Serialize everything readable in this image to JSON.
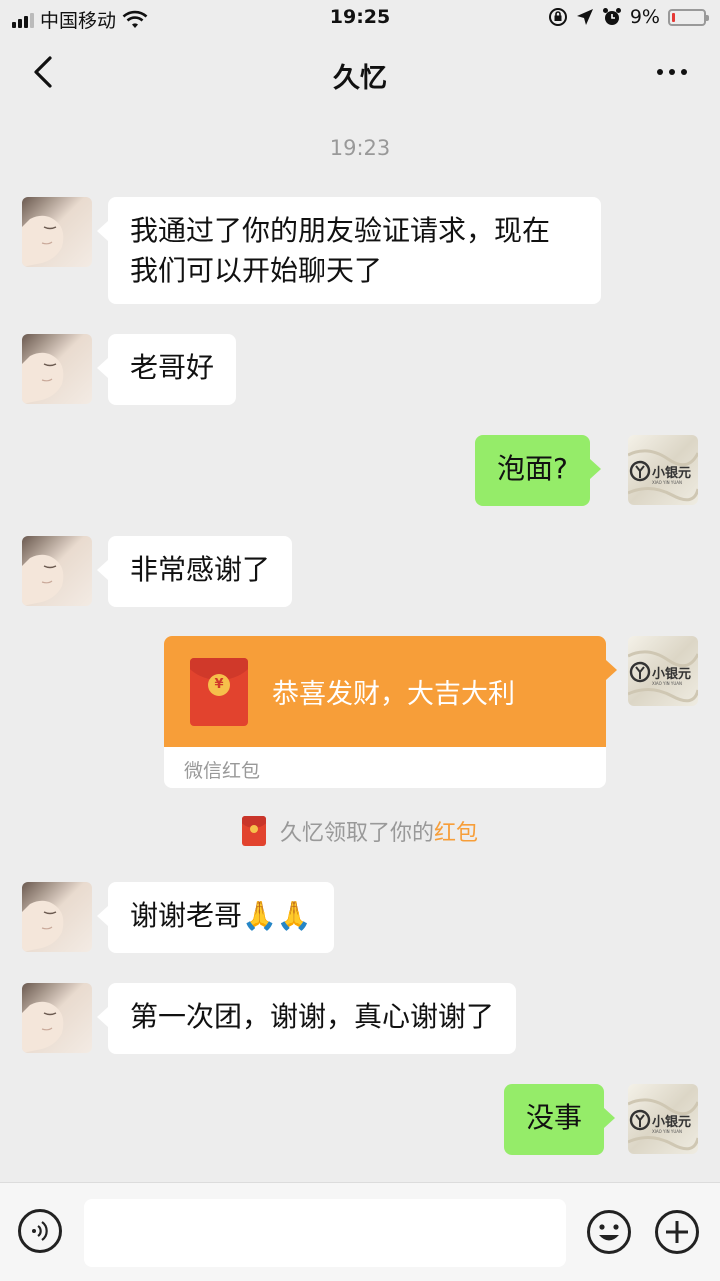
{
  "status_bar": {
    "carrier": "中国移动",
    "time": "19:25",
    "battery_percent": "9%",
    "battery_level": 0.09,
    "icons": [
      "signal-icon",
      "wifi-icon",
      "orientation-lock-icon",
      "location-icon",
      "alarm-icon",
      "battery-icon"
    ]
  },
  "nav": {
    "title": "久忆",
    "back_icon": "chevron-left-icon",
    "more_icon": "more-icon"
  },
  "chat": {
    "timestamp": "19:23",
    "messages": [
      {
        "side": "left",
        "line1": "我通过了你的朋友验证请求，现在",
        "line2": "我们可以开始聊天了"
      },
      {
        "side": "left",
        "text": "老哥好"
      },
      {
        "side": "right",
        "text": "泡面?"
      },
      {
        "side": "left",
        "text": "非常感谢了"
      },
      {
        "side": "right",
        "type": "red-packet",
        "text": "恭喜发财，大吉大利",
        "label": "微信红包",
        "coin": "¥"
      },
      {
        "side": "left",
        "text": "谢谢老哥",
        "emoji": "🙏🙏"
      },
      {
        "side": "left",
        "text": "第一次团，谢谢，真心谢谢了"
      },
      {
        "side": "right",
        "text": "没事"
      }
    ],
    "system_notice": {
      "prefix": "久忆领取了你的",
      "link": "红包"
    },
    "self_avatar_text": "小银元",
    "self_avatar_subtext": "XIAO YIN YUAN"
  },
  "input_bar": {
    "value": "",
    "icons": [
      "voice-icon",
      "emoji-icon",
      "plus-icon"
    ]
  },
  "colors": {
    "background": "#ededed",
    "bubble_self": "#95ec69",
    "bubble_other": "#ffffff",
    "red_packet": "#f79e39",
    "link": "#f79e39"
  }
}
